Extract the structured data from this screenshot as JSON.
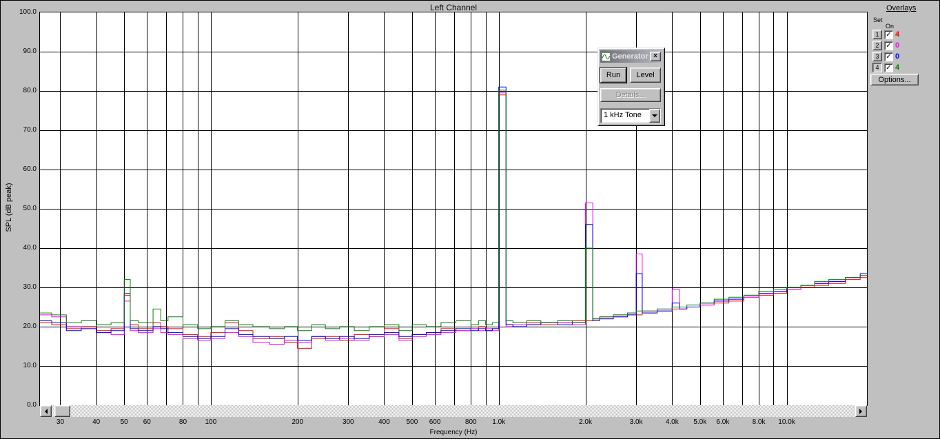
{
  "generator_dialog": {
    "title": "Generator",
    "close_label": "×",
    "run_button": "Run",
    "level_button": "Level",
    "details_button": "Details...",
    "signal_select": "1 kHz Tone"
  },
  "overlays_panel": {
    "title": "Overlays",
    "set_header": "Set",
    "on_header": "On",
    "check_glyph": "✓",
    "options_button": "Options...",
    "rows": [
      {
        "button": "1",
        "checked": true,
        "count": "4",
        "color": "#ff0000",
        "pressed": false
      },
      {
        "button": "2",
        "checked": true,
        "count": "0",
        "color": "#ff00ff",
        "pressed": false
      },
      {
        "button": "3",
        "checked": true,
        "count": "0",
        "color": "#0000ff",
        "pressed": false
      },
      {
        "button": "4",
        "checked": true,
        "count": "4",
        "color": "#008000",
        "pressed": true
      }
    ]
  },
  "chart_data": {
    "type": "line",
    "title": "Left Channel",
    "xlabel": "Frequency (Hz)",
    "ylabel": "SPL (dB peak)",
    "x_scale": "log",
    "xlim": [
      25.5,
      19000
    ],
    "ylim": [
      0,
      100
    ],
    "grid": true,
    "grid_color": "#000000",
    "grid_db": [
      10,
      20,
      30,
      40,
      50,
      60,
      70,
      80,
      90
    ],
    "grid_freqs": [
      30,
      40,
      50,
      60,
      70,
      80,
      90,
      100,
      200,
      300,
      400,
      500,
      600,
      700,
      800,
      900,
      1000,
      2000,
      3000,
      4000,
      5000,
      6000,
      7000,
      8000,
      9000,
      10000
    ],
    "y_ticks": [
      {
        "v": 100,
        "label": "100.0"
      },
      {
        "v": 90,
        "label": "90.0"
      },
      {
        "v": 80,
        "label": "80.0"
      },
      {
        "v": 70,
        "label": "70.0"
      },
      {
        "v": 60,
        "label": "60.0"
      },
      {
        "v": 50,
        "label": "50.0"
      },
      {
        "v": 40,
        "label": "40.0"
      },
      {
        "v": 30,
        "label": "30.0"
      },
      {
        "v": 20,
        "label": "20.0"
      },
      {
        "v": 10,
        "label": "10.0"
      },
      {
        "v": 0,
        "label": "0.0"
      }
    ],
    "x_ticks": [
      {
        "f": 30,
        "label": "30"
      },
      {
        "f": 40,
        "label": "40"
      },
      {
        "f": 50,
        "label": "50"
      },
      {
        "f": 60,
        "label": "60"
      },
      {
        "f": 80,
        "label": "80"
      },
      {
        "f": 100,
        "label": "100"
      },
      {
        "f": 200,
        "label": "200"
      },
      {
        "f": 300,
        "label": "300"
      },
      {
        "f": 400,
        "label": "400"
      },
      {
        "f": 500,
        "label": "500"
      },
      {
        "f": 600,
        "label": "600"
      },
      {
        "f": 800,
        "label": "800"
      },
      {
        "f": 1000,
        "label": "1.0k"
      },
      {
        "f": 2000,
        "label": "2.0k"
      },
      {
        "f": 3000,
        "label": "3.0k"
      },
      {
        "f": 4000,
        "label": "4.0k"
      },
      {
        "f": 5000,
        "label": "5.0k"
      },
      {
        "f": 6000,
        "label": "6.0k"
      },
      {
        "f": 8000,
        "label": "8.0k"
      },
      {
        "f": 10000,
        "label": "10.0k"
      }
    ],
    "freqs": [
      25,
      28,
      31.5,
      35.5,
      40,
      45,
      50,
      52.5,
      56,
      63,
      67,
      71,
      80,
      90,
      100,
      112,
      125,
      140,
      160,
      180,
      200,
      224,
      250,
      280,
      315,
      355,
      400,
      450,
      500,
      560,
      630,
      710,
      800,
      850,
      900,
      950,
      1000,
      1060,
      1120,
      1250,
      1400,
      1600,
      1800,
      2000,
      2120,
      2240,
      2500,
      2800,
      3000,
      3150,
      3550,
      4000,
      4240,
      4500,
      5000,
      5600,
      6300,
      7100,
      8000,
      9000,
      10000,
      11200,
      12500,
      14000,
      16000,
      18000
    ],
    "series": [
      {
        "name": "overlay-1-red",
        "color": "#ff0000",
        "values": [
          21.0,
          20.5,
          19.5,
          20.0,
          19.0,
          19.5,
          28.0,
          20.5,
          19.5,
          21.0,
          20.0,
          19.5,
          18.0,
          17.5,
          18.5,
          21.0,
          19.0,
          17.0,
          17.5,
          16.0,
          14.5,
          17.0,
          17.5,
          16.5,
          18.0,
          17.5,
          19.5,
          17.0,
          18.0,
          18.5,
          19.5,
          19.0,
          19.5,
          20.0,
          19.0,
          19.5,
          79.0,
          20.5,
          20.0,
          21.0,
          20.5,
          21.0,
          21.5,
          21.5,
          22.0,
          22.0,
          22.5,
          23.0,
          23.0,
          23.5,
          24.0,
          24.5,
          24.5,
          25.0,
          25.5,
          26.0,
          26.5,
          27.5,
          28.0,
          28.5,
          29.5,
          30.0,
          30.5,
          31.0,
          32.0,
          32.5
        ]
      },
      {
        "name": "overlay-2-magenta",
        "color": "#ff00ff",
        "values": [
          23.0,
          22.5,
          20.0,
          19.5,
          18.5,
          18.0,
          26.5,
          19.0,
          18.5,
          19.5,
          18.5,
          18.0,
          17.0,
          16.5,
          17.0,
          18.5,
          17.5,
          16.0,
          15.5,
          16.5,
          16.0,
          17.5,
          16.5,
          17.0,
          16.5,
          17.5,
          18.0,
          16.5,
          17.5,
          18.0,
          18.5,
          19.0,
          19.5,
          19.0,
          19.5,
          19.0,
          79.5,
          20.0,
          20.5,
          20.5,
          21.0,
          21.0,
          20.5,
          51.5,
          22.0,
          22.5,
          23.0,
          23.5,
          38.5,
          24.0,
          24.5,
          29.5,
          25.0,
          25.0,
          25.5,
          26.5,
          27.0,
          27.5,
          28.5,
          29.0,
          29.5,
          30.5,
          31.0,
          31.5,
          32.5,
          33.0
        ]
      },
      {
        "name": "overlay-3-blue",
        "color": "#0000ff",
        "values": [
          21.5,
          21.0,
          19.0,
          19.5,
          18.5,
          19.0,
          28.5,
          19.5,
          19.0,
          20.0,
          19.5,
          18.5,
          17.5,
          17.0,
          17.5,
          19.5,
          18.0,
          17.5,
          17.0,
          17.5,
          16.5,
          17.5,
          17.0,
          17.5,
          17.0,
          18.0,
          18.5,
          17.5,
          18.0,
          18.5,
          19.0,
          19.5,
          19.0,
          19.5,
          19.0,
          19.5,
          81.0,
          20.5,
          20.0,
          20.5,
          21.0,
          20.5,
          21.0,
          46.0,
          21.5,
          22.0,
          22.5,
          23.0,
          33.5,
          23.5,
          24.0,
          26.0,
          24.5,
          25.0,
          26.0,
          26.5,
          27.0,
          28.0,
          28.5,
          29.0,
          30.0,
          30.5,
          31.0,
          31.5,
          32.5,
          33.5
        ]
      },
      {
        "name": "overlay-4-green",
        "color": "#008000",
        "values": [
          23.5,
          23.0,
          21.0,
          21.5,
          20.5,
          21.0,
          32.0,
          21.5,
          21.0,
          24.5,
          21.5,
          22.5,
          20.5,
          19.5,
          20.0,
          21.5,
          20.5,
          20.0,
          19.5,
          20.0,
          19.0,
          20.5,
          19.5,
          20.0,
          19.0,
          20.0,
          20.5,
          19.0,
          20.5,
          20.0,
          21.0,
          21.5,
          20.5,
          21.5,
          20.5,
          21.0,
          80.2,
          21.5,
          21.0,
          21.5,
          21.0,
          21.5,
          21.0,
          40.0,
          22.0,
          22.5,
          23.0,
          23.5,
          24.0,
          24.0,
          24.5,
          25.0,
          25.0,
          25.5,
          26.0,
          27.0,
          27.5,
          28.0,
          29.0,
          29.5,
          30.0,
          30.5,
          31.5,
          32.0,
          32.5,
          33.0
        ]
      }
    ]
  }
}
